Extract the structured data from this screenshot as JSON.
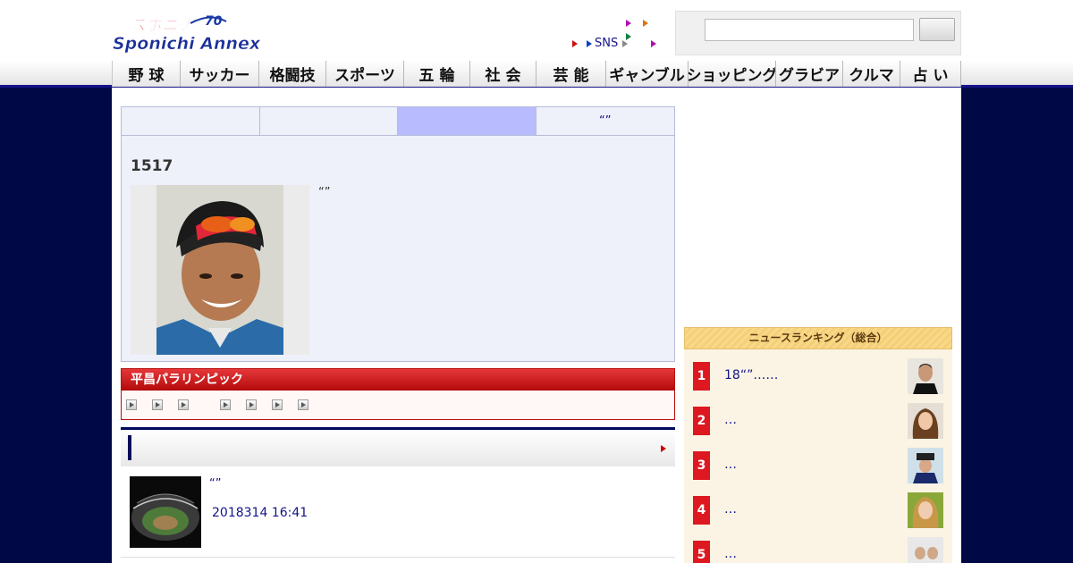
{
  "logo": {
    "top_text": "スポニチ",
    "main_text": "Sponichi Annex",
    "badge": "70"
  },
  "top_links": {
    "sns_label": "SNS"
  },
  "search": {
    "placeholder": "",
    "button_label": ""
  },
  "nav": [
    "野 球",
    "サッカー",
    "格闘技",
    "スポーツ",
    "五 輪",
    "社 会",
    "芸 能",
    "ギャンブル",
    "ショッピング",
    "グラビア",
    "クルマ",
    "占 い"
  ],
  "article": {
    "tabs": [
      "",
      "",
      "",
      "“”"
    ],
    "title": "1517",
    "caption": "“”"
  },
  "paralympic": {
    "heading": "平昌パラリンピック"
  },
  "news": {
    "heading": "",
    "item": {
      "title": "“”",
      "date": "2018314 16:41"
    }
  },
  "ranking": {
    "heading": "ニュースランキング（総合）",
    "items": [
      {
        "rank": "1",
        "text": "18“”……"
      },
      {
        "rank": "2",
        "text": "…"
      },
      {
        "rank": "3",
        "text": "…"
      },
      {
        "rank": "4",
        "text": "…"
      },
      {
        "rank": "5",
        "text": "…"
      }
    ]
  },
  "colors": {
    "navy": "#000845",
    "nav_accent": "#14148a",
    "ranking_red": "#dd1820",
    "paralympic_red": "#c41414"
  }
}
